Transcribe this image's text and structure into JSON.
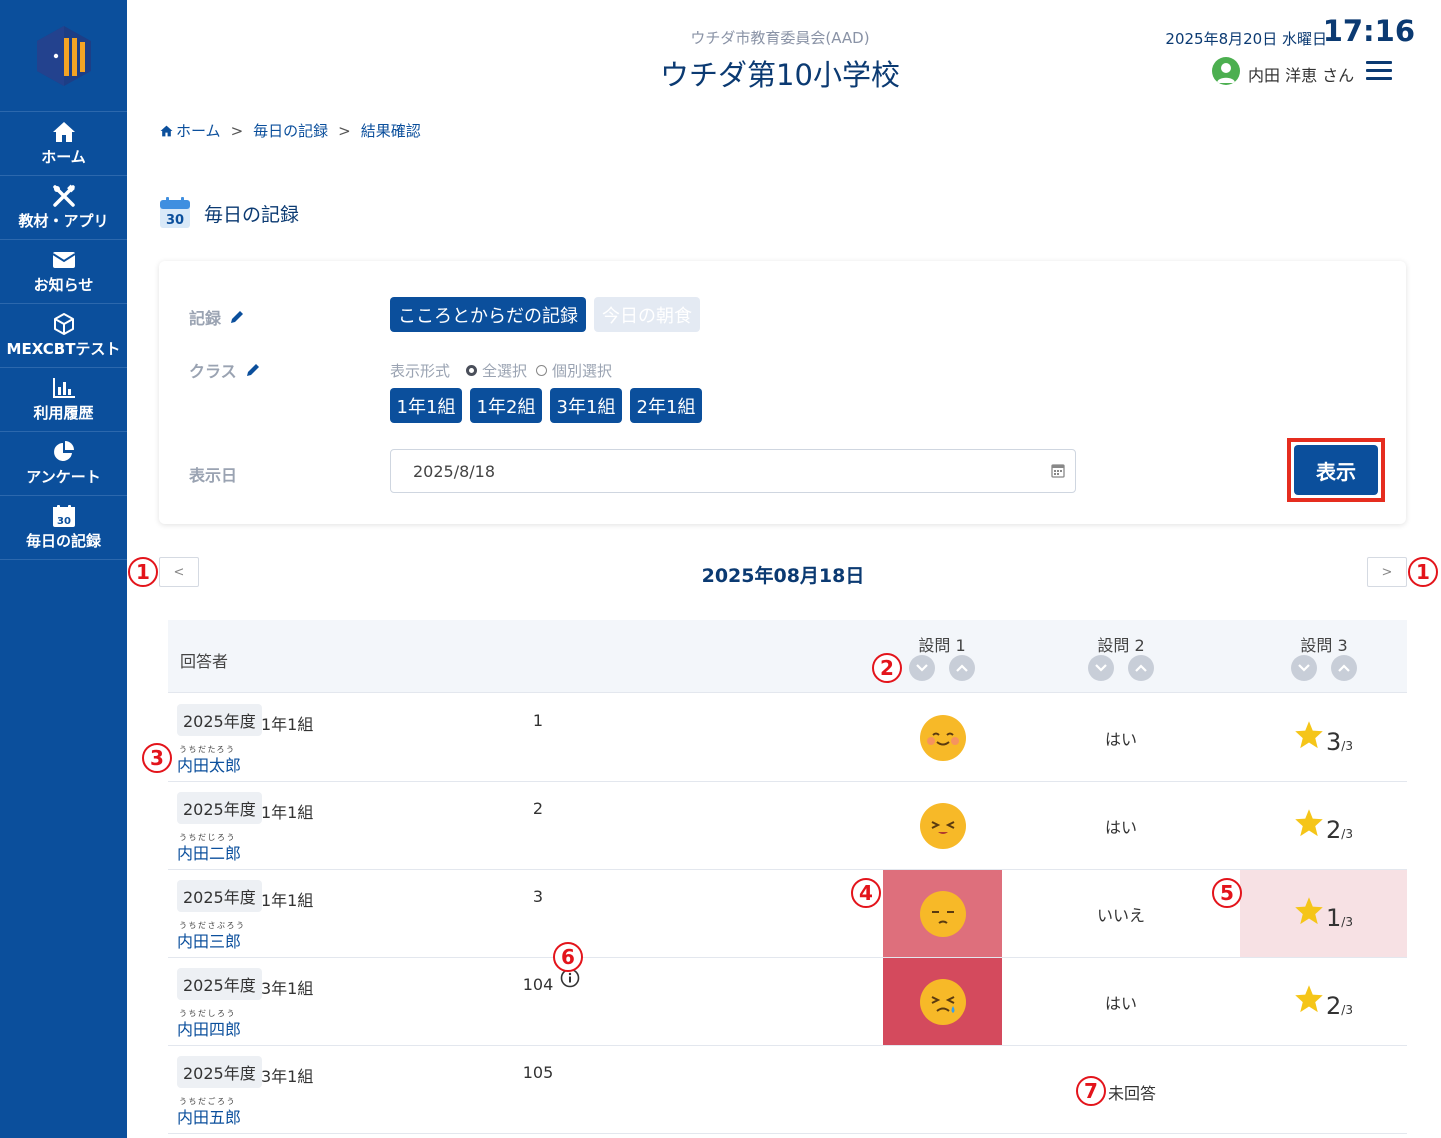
{
  "sidebar": {
    "items": [
      {
        "label": "ホーム",
        "icon": "home-icon"
      },
      {
        "label": "教材・アプリ",
        "icon": "tools-icon"
      },
      {
        "label": "お知らせ",
        "icon": "envelope-icon"
      },
      {
        "label": "MEXCBTテスト",
        "icon": "cube-icon"
      },
      {
        "label": "利用履歴",
        "icon": "bar-chart-icon"
      },
      {
        "label": "アンケート",
        "icon": "pie-chart-icon"
      },
      {
        "label": "毎日の記録",
        "icon": "calendar-icon"
      }
    ],
    "calendar_day": "30"
  },
  "header": {
    "org": "ウチダ市教育委員会(AAD)",
    "school": "ウチダ第10小学校",
    "date": "2025年8月20日 水曜日",
    "time": "17:16",
    "user": "内田 洋恵 さん"
  },
  "breadcrumb": [
    "ホーム",
    "毎日の記録",
    "結果確認"
  ],
  "breadcrumb_sep": ">",
  "page": {
    "title": "毎日の記録",
    "calendar_day": "30"
  },
  "filter": {
    "record_label": "記録",
    "record_options": [
      {
        "label": "こころとからだの記録",
        "active": true
      },
      {
        "label": "今日の朝食",
        "active": false
      }
    ],
    "class_label": "クラス",
    "display_format_label": "表示形式",
    "radio_all": "全選択",
    "radio_individual": "個別選択",
    "classes": [
      "1年1組",
      "1年2組",
      "3年1組",
      "2年1組"
    ],
    "date_label": "表示日",
    "date_value": "2025/8/18",
    "show_button": "表示"
  },
  "date_nav": {
    "prev": "<",
    "next": ">",
    "current": "2025年08月18日"
  },
  "table": {
    "header_respondent": "回答者",
    "questions": [
      "設問 1",
      "設問 2",
      "設問 3"
    ],
    "rows": [
      {
        "year": "2025年度",
        "class": "1年1組",
        "furigana": "うちだたろう",
        "name": "内田太郎",
        "number": "1",
        "q1": "happy",
        "q2": "はい",
        "q3_score": "3",
        "q3_max": "/3"
      },
      {
        "year": "2025年度",
        "class": "1年1組",
        "furigana": "うちだじろう",
        "name": "内田二郎",
        "number": "2",
        "q1": "content",
        "q2": "はい",
        "q3_score": "2",
        "q3_max": "/3"
      },
      {
        "year": "2025年度",
        "class": "1年1組",
        "furigana": "うちださぶろう",
        "name": "内田三郎",
        "number": "3",
        "q1": "sad",
        "q2": "いいえ",
        "q3_score": "1",
        "q3_max": "/3"
      },
      {
        "year": "2025年度",
        "class": "3年1組",
        "furigana": "うちだしろう",
        "name": "内田四郎",
        "number": "104",
        "q1": "crying",
        "q2": "はい",
        "q3_score": "2",
        "q3_max": "/3"
      },
      {
        "year": "2025年度",
        "class": "3年1組",
        "furigana": "うちだごろう",
        "name": "内田五郎",
        "number": "105",
        "unanswered": "未回答"
      }
    ]
  },
  "annotations": [
    "1",
    "2",
    "3",
    "4",
    "5",
    "6",
    "7"
  ],
  "colors": {
    "sidebar": "#0b4f9c",
    "primary": "#0b4f9c",
    "highlight_red": "#e52d1f",
    "annotation_red": "#e3141b",
    "q1_sad_bg": "#de6f7c",
    "q1_crying_bg": "#d44a5d",
    "q3_low_bg": "#f7e1e4",
    "star": "#f5c518",
    "face": "#f7b928"
  }
}
